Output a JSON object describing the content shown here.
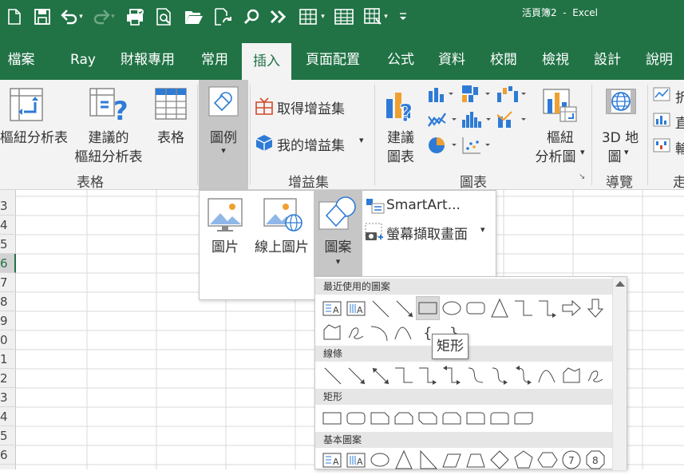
{
  "window": {
    "title": "活頁簿2  -  Excel"
  },
  "qat": {
    "icons": [
      "new-file-icon",
      "save-icon",
      "undo-icon",
      "redo-icon",
      "print-preview-icon",
      "print-icon",
      "open-icon",
      "refresh-icon",
      "search-icon",
      "forward-icon",
      "table-icon",
      "table2-icon",
      "table3-icon",
      "customize-icon"
    ]
  },
  "tabs": [
    {
      "label": "檔案"
    },
    {
      "label": "Ray"
    },
    {
      "label": "財報專用"
    },
    {
      "label": "常用"
    },
    {
      "label": "插入",
      "active": true
    },
    {
      "label": "頁面配置"
    },
    {
      "label": "公式"
    },
    {
      "label": "資料"
    },
    {
      "label": "校閱"
    },
    {
      "label": "檢視"
    },
    {
      "label": "設計"
    },
    {
      "label": "說明"
    }
  ],
  "ribbon": {
    "tables_group": {
      "name": "表格",
      "pivot_label": "樞紐分析表",
      "recommended_label_1": "建議的",
      "recommended_label_2": "樞紐分析表",
      "table_label": "表格"
    },
    "illustrations": {
      "label": "圖例"
    },
    "addins_group": {
      "name": "增益集",
      "get_addins": "取得增益集",
      "my_addins": "我的增益集"
    },
    "charts_group": {
      "name": "圖表",
      "recommended_1": "建議",
      "recommended_2": "圖表",
      "pivot_chart_1": "樞紐",
      "pivot_chart_2": "分析圖"
    },
    "tours_group": {
      "name": "導覽",
      "map_1": "3D 地",
      "map_2": "圖"
    },
    "sparklines_group": {
      "name": "走",
      "line": "折",
      "column": "直",
      "winloss": "輸"
    }
  },
  "illustrations_menu": {
    "pictures": "圖片",
    "online_pictures": "線上圖片",
    "shapes": "圖案",
    "smartart": "SmartArt...",
    "screenshot": "螢幕擷取畫面"
  },
  "shapes_gallery": {
    "categories": {
      "recent": "最近使用的圖案",
      "lines": "線條",
      "rectangles": "矩形",
      "basic": "基本圖案"
    },
    "tooltip": "矩形"
  },
  "sheet": {
    "rows": [
      "3",
      "4",
      "5",
      "6",
      "7",
      "8",
      "9",
      "0",
      "1",
      "2",
      "3",
      "4",
      "5",
      "6"
    ],
    "selected_row_index": 3
  },
  "colors": {
    "brand": "#217346",
    "ribbon_bg": "#f3f3f3",
    "pressed": "#c6c6c6"
  }
}
